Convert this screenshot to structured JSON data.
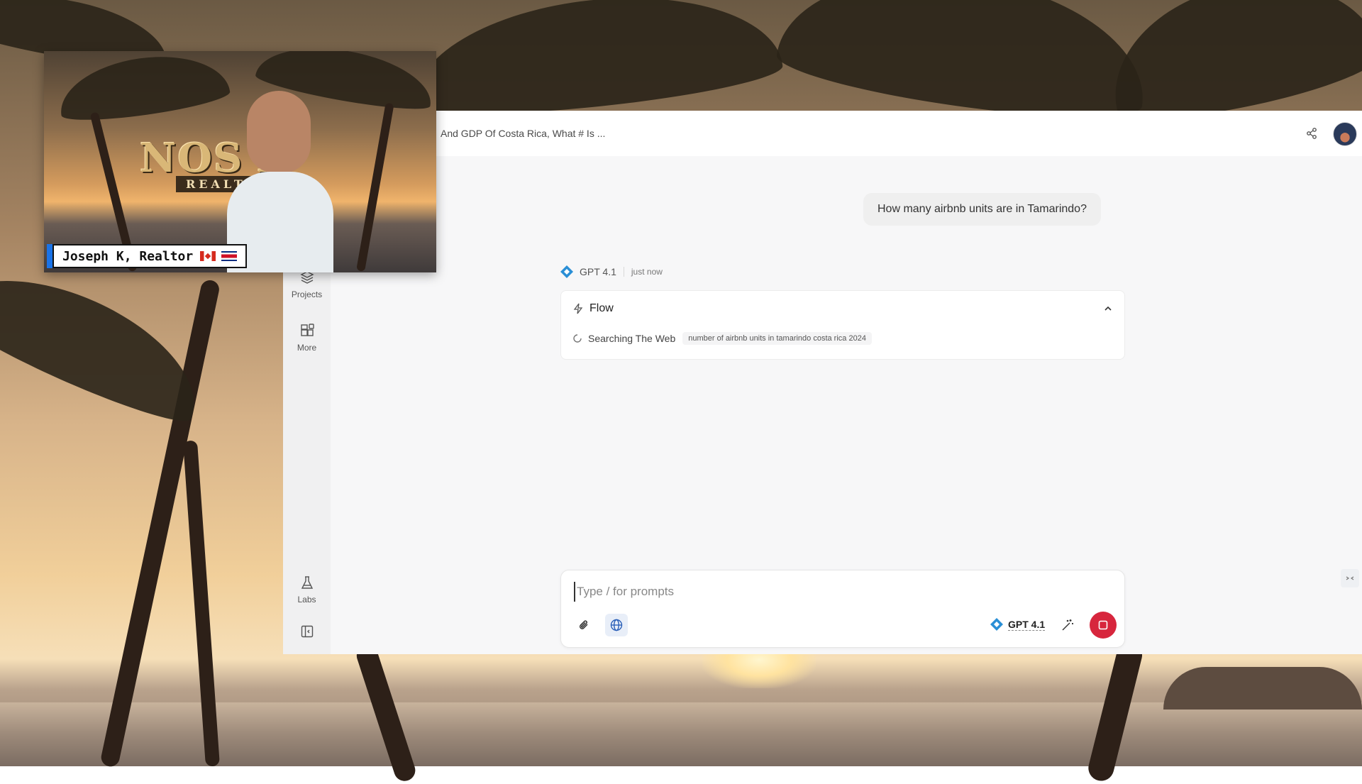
{
  "conversation": {
    "title": "And GDP Of Costa Rica, What # Is ..."
  },
  "sidebar": {
    "items": [
      {
        "label": "Projects",
        "icon": "layers-icon"
      },
      {
        "label": "More",
        "icon": "grid-plus-icon"
      },
      {
        "label": "Labs",
        "icon": "flask-icon"
      }
    ],
    "collapse_icon": "sidebar-collapse-icon"
  },
  "messages": {
    "user": "How many airbnb units are in Tamarindo?",
    "assistant": {
      "model": "GPT 4.1",
      "time": "just now",
      "flow": {
        "title": "Flow",
        "step_label": "Searching The Web",
        "step_query": "number of airbnb units in tamarindo costa rica 2024"
      }
    }
  },
  "composer": {
    "placeholder": "Type / for prompts",
    "value": "",
    "model_label": "GPT 4.1"
  },
  "webcam": {
    "logo_text": "NOS  A",
    "logo_sub": "REALTY",
    "name_tag": "Joseph K, Realtor",
    "flags": [
      "canada-flag",
      "costa-rica-flag"
    ]
  },
  "colors": {
    "accent": "#1a73e8",
    "stop_button": "#d7263d",
    "brand_diamond": "#2a8fd6"
  }
}
